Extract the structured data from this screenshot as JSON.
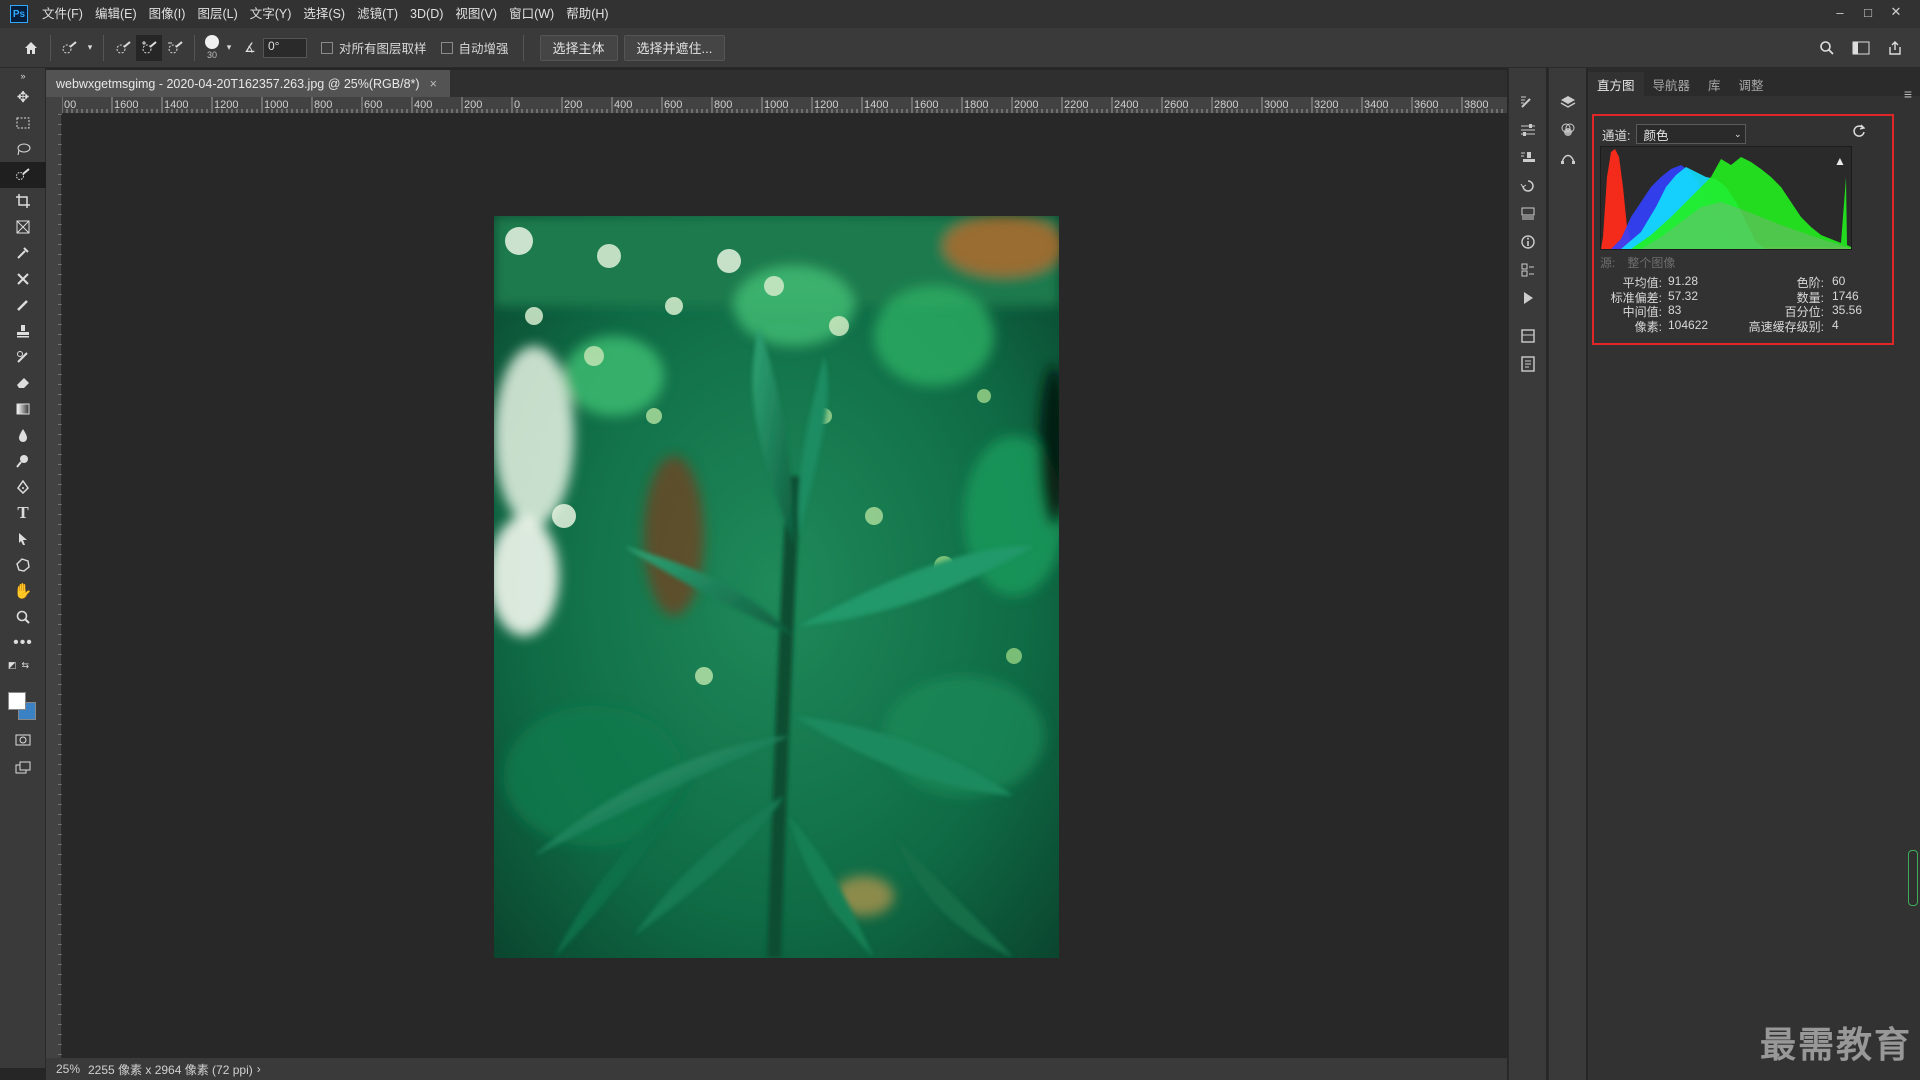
{
  "app": {
    "logo": "Ps"
  },
  "menu": [
    "文件(F)",
    "编辑(E)",
    "图像(I)",
    "图层(L)",
    "文字(Y)",
    "选择(S)",
    "滤镜(T)",
    "3D(D)",
    "视图(V)",
    "窗口(W)",
    "帮助(H)"
  ],
  "window_controls": [
    "–",
    "□",
    "✕"
  ],
  "options": {
    "brush_size": "30",
    "angle": "0°",
    "sample_all_layers": "对所有图层取样",
    "auto_enhance": "自动增强",
    "select_subject": "选择主体",
    "select_and_mask": "选择并遮住..."
  },
  "document": {
    "tab_title": "webwxgetmsgimg - 2020-04-20T162357.263.jpg @ 25%(RGB/8*)",
    "close": "×"
  },
  "ruler": {
    "h_labels": [
      "00",
      "1600",
      "1400",
      "1200",
      "1000",
      "800",
      "600",
      "400",
      "200",
      "0",
      "200",
      "400",
      "600",
      "800",
      "1000",
      "1200",
      "1400",
      "1600",
      "1800",
      "2000",
      "2200",
      "2400",
      "2600",
      "2800",
      "3000",
      "3200",
      "3400",
      "3600",
      "3800"
    ]
  },
  "status": {
    "zoom": "25%",
    "info": "2255 像素 x 2964 像素 (72 ppi)",
    "arrow": "›"
  },
  "panel": {
    "tabs": [
      "直方图",
      "导航器",
      "库",
      "调整"
    ],
    "channel_label": "通道:",
    "channel_value": "颜色",
    "source_label": "源:",
    "source_value": "整个图像",
    "stats": {
      "mean_label": "平均值:",
      "mean": "91.28",
      "std_label": "标准偏差:",
      "std": "57.32",
      "median_label": "中间值:",
      "median": "83",
      "pixels_label": "像素:",
      "pixels": "104622",
      "level_label": "色阶:",
      "level": "60",
      "count_label": "数量:",
      "count": "1746",
      "percentile_label": "百分位:",
      "percentile": "35.56",
      "cache_label": "高速缓存级别:",
      "cache": "4"
    }
  },
  "watermark": "最需教育",
  "colors": {
    "highlight_box": "#e02626",
    "foreground": "#ffffff",
    "background": "#3b82c4"
  }
}
